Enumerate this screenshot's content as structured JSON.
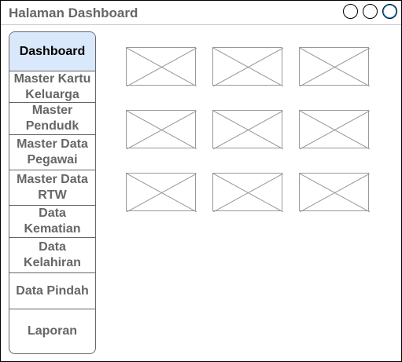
{
  "window": {
    "title": "Halaman Dashboard",
    "controls": [
      "window-button",
      "window-button",
      "window-button"
    ]
  },
  "sidebar": {
    "items": [
      {
        "label": "Dashboard",
        "active": true
      },
      {
        "label": "Master Kartu Keluarga"
      },
      {
        "label": "Master Pendudk"
      },
      {
        "label": "Master Data Pegawai"
      },
      {
        "label": "Master Data RTW"
      },
      {
        "label": "Data Kematian"
      },
      {
        "label": "Data Kelahiran"
      },
      {
        "label": "Data Pindah"
      },
      {
        "label": "Laporan"
      }
    ]
  },
  "main": {
    "placeholders": {
      "rows": 3,
      "cols": 3,
      "icon": "image-placeholder-icon"
    }
  },
  "colors": {
    "active_bg": "#dae8fc",
    "text": "#666666",
    "border": "#666666",
    "placeholder_stroke": "#999999",
    "window_button_accent": "#1ba1e2"
  }
}
